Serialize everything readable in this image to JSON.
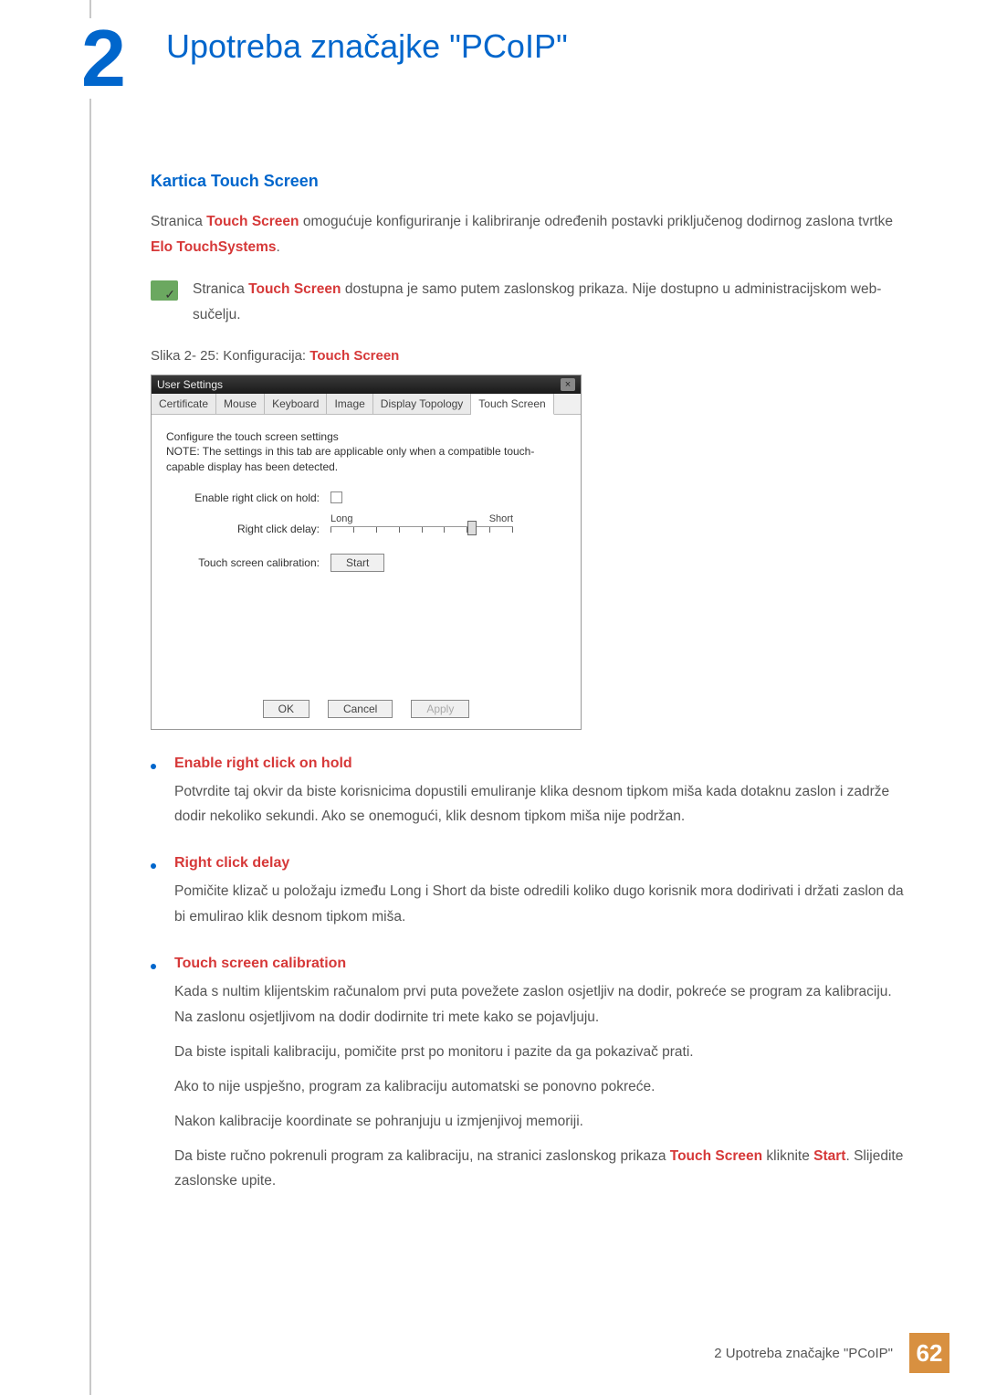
{
  "chapter": {
    "number": "2",
    "title": "Upotreba značajke \"PCoIP\""
  },
  "section": {
    "heading": "Kartica Touch Screen",
    "intro_pre": "Stranica ",
    "intro_hl1": "Touch Screen",
    "intro_mid": " omogućuje konfiguriranje i kalibriranje određenih postavki priključenog dodirnog zaslona tvrtke  ",
    "intro_hl2": "Elo TouchSystems",
    "intro_post": ".",
    "note_pre": "Stranica ",
    "note_hl": "Touch Screen",
    "note_post": " dostupna je samo putem zaslonskog prikaza. Nije dostupno u administracijskom web-sučelju.",
    "figure_pre": "Slika 2- 25: Konfiguracija: ",
    "figure_hl": "Touch Screen"
  },
  "screenshot": {
    "title": "User Settings",
    "tabs": [
      "Certificate",
      "Mouse",
      "Keyboard",
      "Image",
      "Display Topology",
      "Touch Screen"
    ],
    "active_tab_index": 5,
    "note_line1": "Configure the touch screen settings",
    "note_line2": "NOTE: The settings in this tab are applicable only when a compatible touch-capable display has been detected.",
    "row1_label": "Enable right click on hold:",
    "row2_label": "Right click delay:",
    "slider_left": "Long",
    "slider_right": "Short",
    "row3_label": "Touch screen calibration:",
    "start_btn": "Start",
    "ok": "OK",
    "cancel": "Cancel",
    "apply": "Apply"
  },
  "bullets": [
    {
      "title": "Enable right click on hold",
      "paras": [
        "Potvrdite taj okvir da biste korisnicima dopustili emuliranje klika desnom tipkom miša kada dotaknu zaslon i zadrže dodir nekoliko sekundi. Ako se onemogući, klik desnom tipkom miša nije podržan."
      ]
    },
    {
      "title": "Right click delay",
      "paras": [
        "Pomičite klizač u položaju između Long i Short da biste odredili koliko dugo korisnik mora dodirivati i držati zaslon da bi emulirao klik desnom tipkom miša."
      ]
    },
    {
      "title": "Touch screen calibration",
      "paras": [
        "Kada s nultim klijentskim računalom prvi puta povežete zaslon osjetljiv na dodir, pokreće se program za kalibraciju. Na zaslonu osjetljivom na dodir dodirnite tri mete kako se pojavljuju.",
        "Da biste ispitali kalibraciju, pomičite prst po monitoru i pazite da ga pokazivač prati.",
        "Ako to nije uspješno, program za kalibraciju automatski se ponovno pokreće.",
        "Nakon kalibracije koordinate se pohranjuju u izmjenjivoj memoriji."
      ],
      "last": {
        "pre": "Da biste ručno pokrenuli program za kalibraciju, na stranici zaslonskog prikaza ",
        "hl1": "Touch Screen",
        "mid": " kliknite ",
        "hl2": "Start",
        "post": ". Slijedite zaslonske upite."
      }
    }
  ],
  "footer": {
    "text": "2 Upotreba značajke \"PCoIP\"",
    "page": "62"
  }
}
